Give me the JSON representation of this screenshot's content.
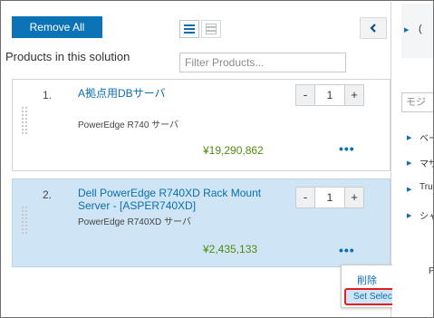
{
  "toolbar": {
    "remove_all_label": "Remove All",
    "section_title": "Products in this solution",
    "filter_placeholder": "Filter Products..."
  },
  "products": [
    {
      "index": "1.",
      "name": "A拠点用DBサーバ",
      "model": "PowerEdge R740 サーバ",
      "price": "¥19,290,862",
      "quantity": "1",
      "selected": false
    },
    {
      "index": "2.",
      "name_line1": "Dell PowerEdge R740XD Rack Mount",
      "name_line2": "Server - [ASPER740XD]",
      "model": "PowerEdge R740XD サーバ",
      "price": "¥2,435,133",
      "quantity": "1",
      "selected": true
    }
  ],
  "quantity_controls": {
    "decrement": "-",
    "increment": "+"
  },
  "context_menu": {
    "delete_label": "削除",
    "set_selections_label": "Set Selections"
  },
  "right_panel": {
    "head_fragment": "(",
    "input_fragment": "モジ",
    "items": [
      "ベー",
      "マザ",
      "Tru",
      "シャ"
    ],
    "bottom_fragment": "P"
  },
  "colors": {
    "primary_blue": "#0b73b6",
    "link_blue": "#0b6fb0",
    "price_green": "#4f8b10",
    "selected_bg": "#cfe4f5",
    "highlight_red": "#e02020"
  }
}
